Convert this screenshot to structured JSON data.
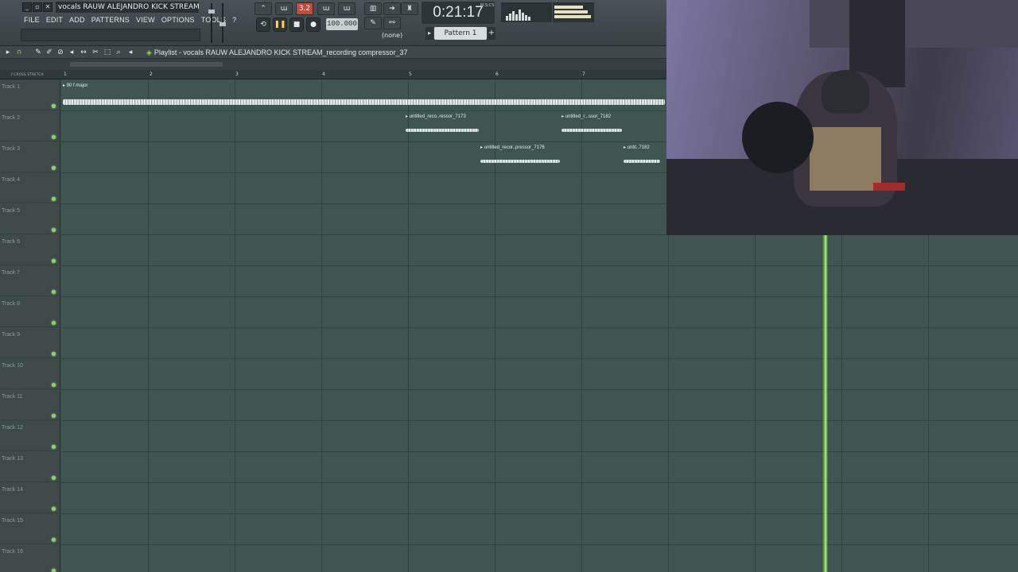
{
  "window": {
    "file_title": "vocals RAUW ALEJANDRO KICK STREAM.flp"
  },
  "menu": [
    "FILE",
    "EDIT",
    "ADD",
    "PATTERNS",
    "VIEW",
    "OPTIONS",
    "TOOLS",
    "?"
  ],
  "transport": {
    "snap_label": "3.2",
    "tempo": "100.000",
    "time": "0:21:17",
    "time_unit": "M:S:CS",
    "pattern_none": "(none)",
    "pattern": "Pattern 1"
  },
  "playlist": {
    "title": "Playlist - vocals RAUW ALEJANDRO KICK STREAM_recording compressor_37",
    "ruler_modes": "F.CROSS STRETCH",
    "bars": [
      "1",
      "2",
      "3",
      "4",
      "5",
      "6",
      "7"
    ],
    "tracks": [
      "Track 1",
      "Track 2",
      "Track 3",
      "Track 4",
      "Track 5",
      "Track 6",
      "Track 7",
      "Track 8",
      "Track 9",
      "Track 10",
      "Track 11",
      "Track 12",
      "Track 13",
      "Track 14",
      "Track 15",
      "Track 16"
    ],
    "clips": {
      "main": "90 f major",
      "c1": "untitled_reco..ressor_7173",
      "c2": "untitled_r...ssor_7182",
      "c3": "untitled_recor..pressor_7176",
      "c4": "untit..7182"
    }
  },
  "colors": {
    "grid": "#3e5552",
    "playhead": "#6dd43b",
    "track_led": "#8fd16a",
    "snap_active": "#c44a3a"
  }
}
